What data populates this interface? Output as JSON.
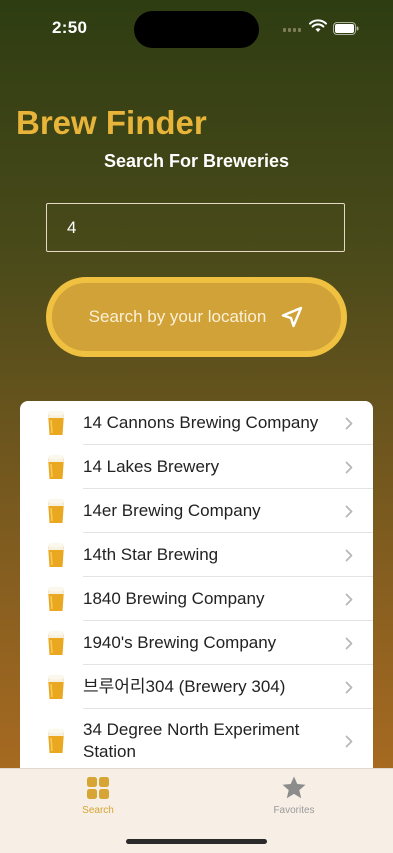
{
  "status_bar": {
    "time": "2:50"
  },
  "header": {
    "title": "Brew Finder",
    "subtitle": "Search For Breweries"
  },
  "search": {
    "value": "4"
  },
  "location_button": {
    "label": "Search by your location"
  },
  "breweries": [
    {
      "name": "14 Cannons Brewing Company"
    },
    {
      "name": "14 Lakes Brewery"
    },
    {
      "name": "14er Brewing Company"
    },
    {
      "name": "14th Star Brewing"
    },
    {
      "name": "1840 Brewing Company"
    },
    {
      "name": "1940's Brewing Company"
    },
    {
      "name": "브루어리304 (Brewery 304)"
    },
    {
      "name": "34 Degree North Experiment Station"
    }
  ],
  "tabbar": {
    "tabs": [
      {
        "label": "Search",
        "icon": "grid-icon",
        "selected": true
      },
      {
        "label": "Favorites",
        "icon": "star-icon",
        "selected": false
      }
    ]
  },
  "colors": {
    "accent": "#e8b53a",
    "button": "#d1a237",
    "button_border": "#f0c040"
  }
}
